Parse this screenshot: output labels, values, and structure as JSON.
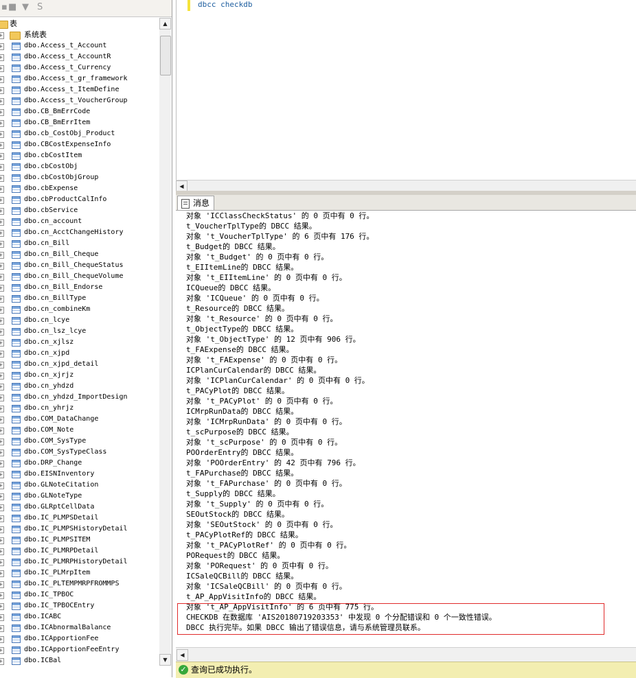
{
  "tree": {
    "header": "表",
    "system_folder": "系统表",
    "tables": [
      "dbo.Access_t_Account",
      "dbo.Access_t_AccountR",
      "dbo.Access_t_Currency",
      "dbo.Access_t_gr_framework",
      "dbo.Access_t_ItemDefine",
      "dbo.Access_t_VoucherGroup",
      "dbo.CB_BmErrCode",
      "dbo.CB_BmErrItem",
      "dbo.cb_CostObj_Product",
      "dbo.CBCostExpenseInfo",
      "dbo.cbCostItem",
      "dbo.cbCostObj",
      "dbo.cbCostObjGroup",
      "dbo.cbExpense",
      "dbo.cbProductCalInfo",
      "dbo.cbService",
      "dbo.cn_account",
      "dbo.cn_AcctChangeHistory",
      "dbo.cn_Bill",
      "dbo.cn_Bill_Cheque",
      "dbo.cn_Bill_ChequeStatus",
      "dbo.cn_Bill_ChequeVolume",
      "dbo.cn_Bill_Endorse",
      "dbo.cn_BillType",
      "dbo.cn_combineKm",
      "dbo.cn_lcye",
      "dbo.cn_lsz_lcye",
      "dbo.cn_xjlsz",
      "dbo.cn_xjpd",
      "dbo.cn_xjpd_detail",
      "dbo.cn_xjrjz",
      "dbo.cn_yhdzd",
      "dbo.cn_yhdzd_ImportDesign",
      "dbo.cn_yhrjz",
      "dbo.COM_DataChange",
      "dbo.COM_Note",
      "dbo.COM_SysType",
      "dbo.COM_SysTypeClass",
      "dbo.DRP_Change",
      "dbo.EISNInventory",
      "dbo.GLNoteCitation",
      "dbo.GLNoteType",
      "dbo.GLRptCellData",
      "dbo.IC_PLMPSDetail",
      "dbo.IC_PLMPSHistoryDetail",
      "dbo.IC_PLMPSITEM",
      "dbo.IC_PLMRPDetail",
      "dbo.IC_PLMRPHistoryDetail",
      "dbo.IC_PLMrpItem",
      "dbo.IC_PLTEMPMRPFROMMPS",
      "dbo.IC_TPBOC",
      "dbo.IC_TPBOCEntry",
      "dbo.ICABC",
      "dbo.ICAbnormalBalance",
      "dbo.ICApportionFee",
      "dbo.ICApportionFeeEntry",
      "dbo.ICBal"
    ]
  },
  "editor": {
    "code": "dbcc checkdb"
  },
  "messages": {
    "tab_label": "消息",
    "lines": [
      "对象 'ICClassCheckStatus' 的 0 页中有 0 行。",
      "t_VoucherTplType的 DBCC 结果。",
      "对象 't_VoucherTplType' 的 6 页中有 176 行。",
      "t_Budget的 DBCC 结果。",
      "对象 't_Budget' 的 0 页中有 0 行。",
      "t_EIItemLine的 DBCC 结果。",
      "对象 't_EIItemLine' 的 0 页中有 0 行。",
      "ICQueue的 DBCC 结果。",
      "对象 'ICQueue' 的 0 页中有 0 行。",
      "t_Resource的 DBCC 结果。",
      "对象 't_Resource' 的 0 页中有 0 行。",
      "t_ObjectType的 DBCC 结果。",
      "对象 't_ObjectType' 的 12 页中有 906 行。",
      "t_FAExpense的 DBCC 结果。",
      "对象 't_FAExpense' 的 0 页中有 0 行。",
      "ICPlanCurCalendar的 DBCC 结果。",
      "对象 'ICPlanCurCalendar' 的 0 页中有 0 行。",
      "t_PACyPlot的 DBCC 结果。",
      "对象 't_PACyPlot' 的 0 页中有 0 行。",
      "ICMrpRunData的 DBCC 结果。",
      "对象 'ICMrpRunData' 的 0 页中有 0 行。",
      "t_scPurpose的 DBCC 结果。",
      "对象 't_scPurpose' 的 0 页中有 0 行。",
      "POOrderEntry的 DBCC 结果。",
      "对象 'POOrderEntry' 的 42 页中有 796 行。",
      "t_FAPurchase的 DBCC 结果。",
      "对象 't_FAPurchase' 的 0 页中有 0 行。",
      "t_Supply的 DBCC 结果。",
      "对象 't_Supply' 的 0 页中有 0 行。",
      "SEOutStock的 DBCC 结果。",
      "对象 'SEOutStock' 的 0 页中有 0 行。",
      "t_PACyPlotRef的 DBCC 结果。",
      "对象 't_PACyPlotRef' 的 0 页中有 0 行。",
      "PORequest的 DBCC 结果。",
      "对象 'PORequest' 的 0 页中有 0 行。",
      "ICSaleQCBill的 DBCC 结果。",
      "对象 'ICSaleQCBill' 的 0 页中有 0 行。",
      "t_AP_AppVisitInfo的 DBCC 结果。",
      "对象 't_AP_AppVisitInfo' 的 6 页中有 775 行。",
      "CHECKDB 在数据库 'AIS20180719203353' 中发现 0 个分配错误和 0 个一致性错误。",
      "DBCC 执行完毕。如果 DBCC 输出了错误信息，请与系统管理员联系。"
    ]
  },
  "status": {
    "text": "查询已成功执行。",
    "icon": "check-circle-icon"
  }
}
